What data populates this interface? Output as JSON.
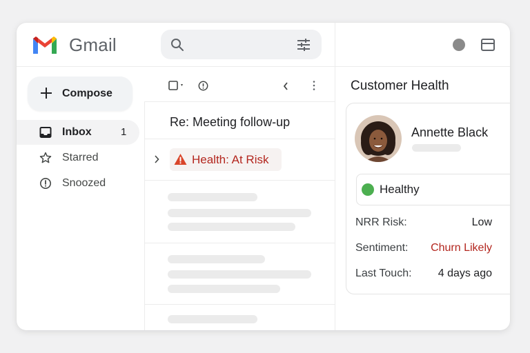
{
  "app": {
    "brand": "Gmail"
  },
  "search": {
    "placeholder": ""
  },
  "sidebar": {
    "compose_label": "Compose",
    "items": [
      {
        "label": "Inbox",
        "count": "1",
        "icon": "inbox-icon"
      },
      {
        "label": "Starred",
        "count": "",
        "icon": "star-icon"
      },
      {
        "label": "Snoozed",
        "count": "",
        "icon": "snooze-clock-icon"
      }
    ]
  },
  "mail": {
    "subject": "Re: Meeting follow-up",
    "health_tag": "Health: At Risk"
  },
  "panel": {
    "title": "Customer Health",
    "contact_name": "Annette Black",
    "status": "Healthy",
    "fields": [
      {
        "label": "NRR Risk:",
        "value": "Low"
      },
      {
        "label": "Sentiment:",
        "value": "Churn Likely"
      },
      {
        "label": "Last Touch:",
        "value": "4 days ago"
      }
    ]
  },
  "colors": {
    "accent_red": "#b3261e",
    "healthy_green": "#4caf50",
    "background": "#f1f1f2"
  }
}
